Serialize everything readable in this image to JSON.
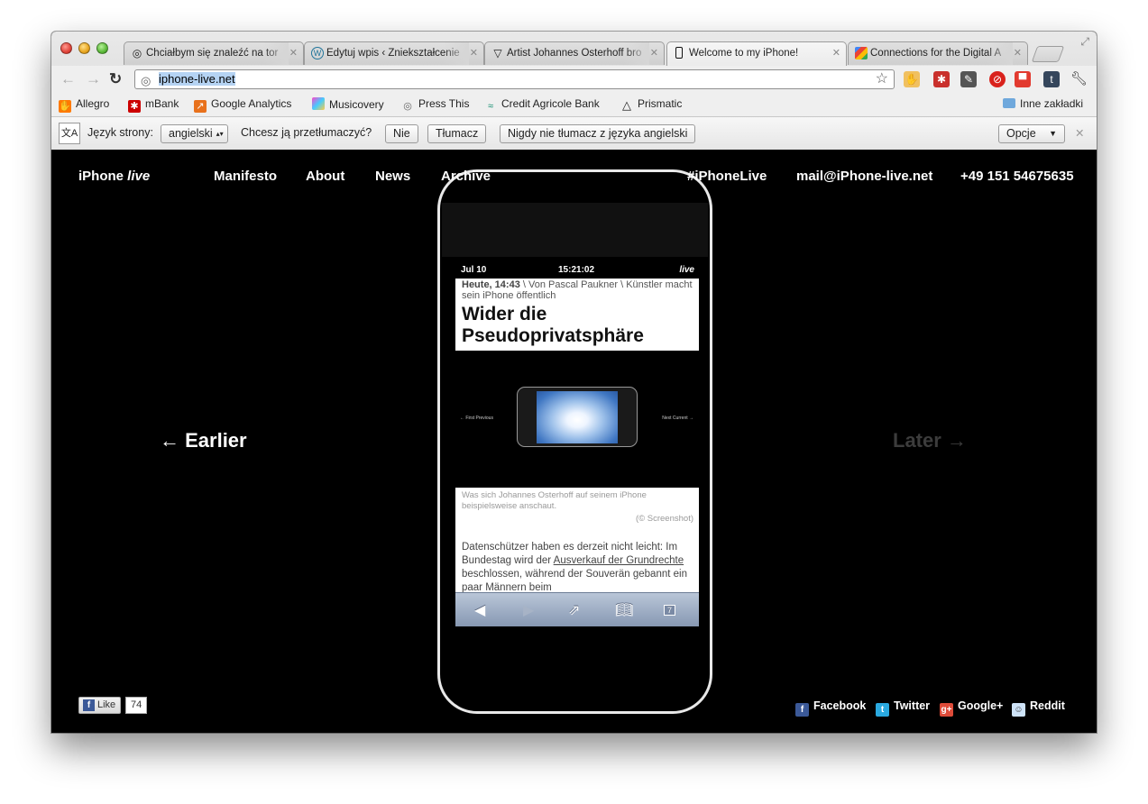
{
  "tabs": [
    {
      "title": "Chciałbym się znaleźć na tor",
      "icon": "globe-icon",
      "active": false
    },
    {
      "title": "Edytuj wpis ‹ Zniekształcenie",
      "icon": "wordpress-icon",
      "active": false
    },
    {
      "title": "Artist Johannes Osterhoff bro",
      "icon": "triangle-icon",
      "active": false
    },
    {
      "title": "Welcome to my iPhone! ",
      "icon": "iphone-icon",
      "active": true
    },
    {
      "title": "Connections for the Digital A",
      "icon": "google-icon",
      "active": false
    }
  ],
  "omnibox": {
    "url": "iphone-live.net"
  },
  "bookmarks": [
    {
      "label": "Allegro"
    },
    {
      "label": "mBank"
    },
    {
      "label": "Google Analytics"
    },
    {
      "label": "Musicovery"
    },
    {
      "label": "Press This"
    },
    {
      "label": "Credit Agricole Bank"
    },
    {
      "label": "Prismatic"
    }
  ],
  "other_bookmarks": "Inne zakładki",
  "translate": {
    "language_label": "Język strony:",
    "language_value": "angielski",
    "question": "Chcesz ją przetłumaczyć?",
    "no": "Nie",
    "translate": "Tłumacz",
    "never": "Nigdy nie tłumacz z języka angielski",
    "options": "Opcje"
  },
  "site": {
    "logo_main": "iPhone ",
    "logo_italic": "live",
    "nav": [
      "Manifesto",
      "About",
      "News",
      "Archive"
    ],
    "hashtag": "#iPhoneLive",
    "email": "mail@iPhone-live.net",
    "phone": "+49 151 54675635",
    "earlier": "← Earlier",
    "later": "Later →"
  },
  "phone_screen": {
    "date": "Jul 10",
    "time": "15:21:02",
    "live": "live",
    "meta_bold": "Heute, 14:43",
    "meta_rest": " \\ Von Pascal Paukner \\ Künstler macht sein iPhone öffentlich",
    "headline": "Wider die Pseudoprivatsphäre",
    "nav_left": "← First  Previous",
    "nav_right": "Next  Current →",
    "caption": "Was sich Johannes Osterhoff auf seinem iPhone beispielsweise anschaut.",
    "credit": "(© Screenshot)",
    "body_1": "Datenschützer haben es derzeit nicht leicht: Im Bundestag wird der ",
    "body_link": "Ausverkauf der Grundrechte",
    "body_2": " beschlossen, während der Souverän gebannt ein paar Männern beim",
    "tabs_count": "7"
  },
  "social": {
    "like": "Like",
    "like_count": "74",
    "facebook": "Facebook",
    "twitter": "Twitter",
    "googleplus": "Google+",
    "reddit": "Reddit"
  }
}
